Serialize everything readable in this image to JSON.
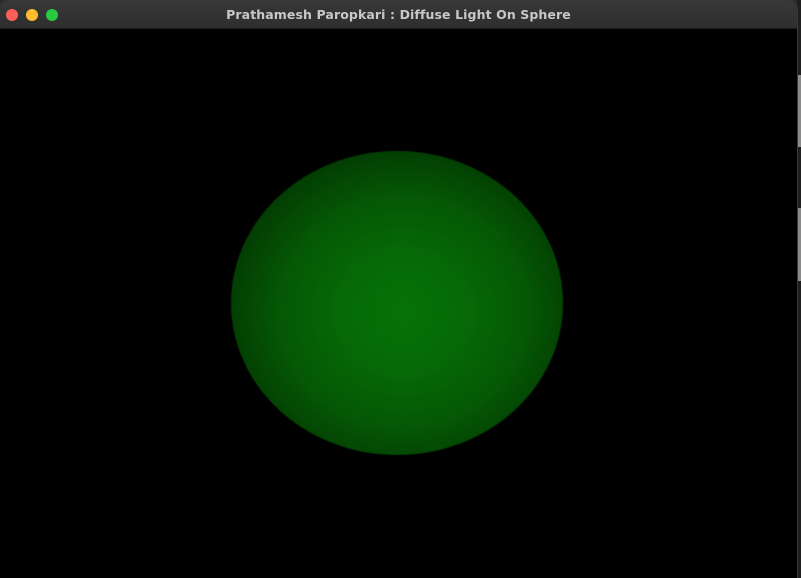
{
  "window": {
    "title": "Prathamesh Paropkari : Diffuse Light On Sphere"
  },
  "scene": {
    "background_color": "#000000",
    "sphere_color": "#077307",
    "lighting": "diffuse"
  }
}
